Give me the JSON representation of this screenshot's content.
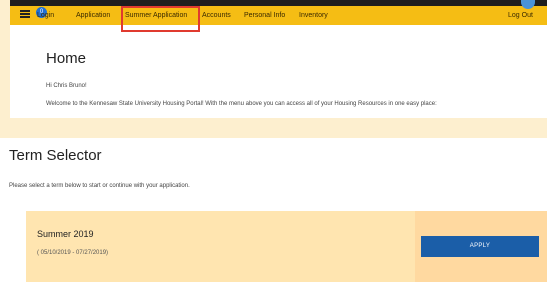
{
  "nav": {
    "badge": "0",
    "items": [
      {
        "label": "Login"
      },
      {
        "label": "Application"
      },
      {
        "label": "Summer Application"
      },
      {
        "label": "Accounts"
      },
      {
        "label": "Personal Info"
      },
      {
        "label": "Inventory"
      }
    ],
    "logout": "Log Out"
  },
  "home": {
    "title": "Home",
    "greeting": "Hi Chris Bruno!",
    "welcome": "Welcome to the Kennesaw State University Housing Portal! With the menu above you can access all of your Housing Resources in one easy place:"
  },
  "term_selector": {
    "title": "Term Selector",
    "subtitle": "Please select a term below to start or continue with your application.",
    "term": {
      "name": "Summer 2019",
      "dates": "( 05/10/2019 - 07/27/2019)",
      "apply_label": "APPLY"
    }
  },
  "colors": {
    "navbar": "#f5bd14",
    "highlight": "#e03a2f",
    "apply_button": "#1b5ea8",
    "term_card": "#ffe5b0"
  }
}
